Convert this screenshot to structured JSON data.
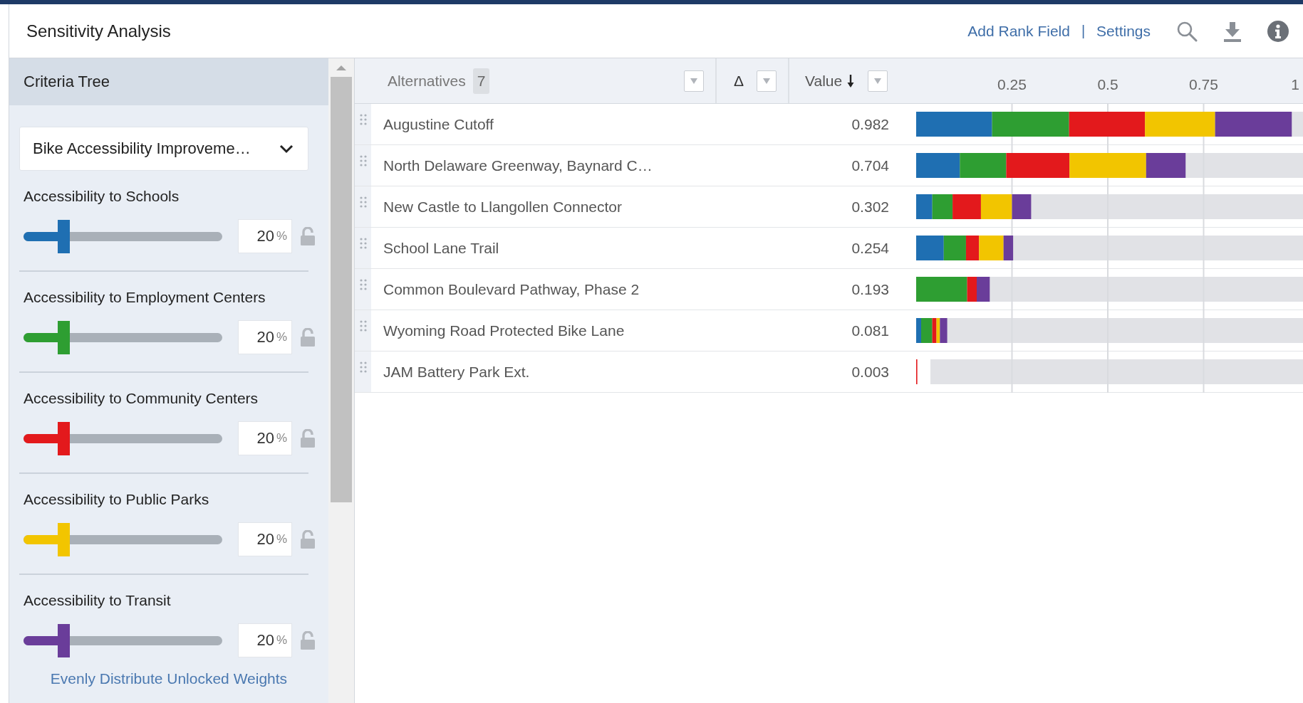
{
  "header": {
    "title": "Sensitivity Analysis",
    "links": [
      "Add Rank Field",
      "Settings"
    ],
    "separator": "|"
  },
  "criteria_tree": {
    "title": "Criteria Tree",
    "dropdown": {
      "value": "Bike Accessibility Improveme…"
    },
    "criteria": [
      {
        "name": "Accessibility to Schools",
        "color": "#1f6fb2",
        "level": 0.2,
        "weight": "20",
        "unit": "%",
        "locked": false
      },
      {
        "name": "Accessibility to Employment Centers",
        "color": "#2e9e32",
        "level": 0.2,
        "weight": "20",
        "unit": "%",
        "locked": false
      },
      {
        "name": "Accessibility to Community Centers",
        "color": "#e3191c",
        "level": 0.2,
        "weight": "20",
        "unit": "%",
        "locked": false
      },
      {
        "name": "Accessibility to Public Parks",
        "color": "#f2c500",
        "level": 0.2,
        "weight": "20",
        "unit": "%",
        "locked": false
      },
      {
        "name": "Accessibility to Transit",
        "color": "#6a3d9a",
        "level": 0.2,
        "weight": "20",
        "unit": "%",
        "locked": false
      }
    ],
    "action": "Evenly Distribute Unlocked Weights"
  },
  "table": {
    "columns": [
      {
        "label": "Alternatives",
        "count": "7"
      },
      {
        "label": "Δ"
      },
      {
        "label": "Value",
        "sort_descending": true
      }
    ],
    "rows": [
      {
        "name": "Augustine Cutoff",
        "value": "0.982"
      },
      {
        "name": "North Delaware Greenway, Baynard C…",
        "value": "0.704"
      },
      {
        "name": "New Castle to Llangollen Connector",
        "value": "0.302"
      },
      {
        "name": "School Lane Trail",
        "value": "0.254"
      },
      {
        "name": "Common Boulevard Pathway, Phase 2",
        "value": "0.193"
      },
      {
        "name": "Wyoming Road Protected Bike Lane",
        "value": "0.081"
      },
      {
        "name": "JAM Battery Park Ext.",
        "value": "0.003"
      }
    ],
    "chart_data": {
      "type": "bar",
      "orientation": "horizontal",
      "stacked": true,
      "grid": true,
      "xlim": [
        0,
        1
      ],
      "xticks": [
        {
          "value": 0.25,
          "label": "0.25"
        },
        {
          "value": 0.5,
          "label": "0.5"
        },
        {
          "value": 0.75,
          "label": "0.75"
        },
        {
          "value": 1,
          "label": "1"
        }
      ],
      "series": [
        {
          "color": "#1f6fb2",
          "values": [
            0.198,
            0.114,
            0.042,
            0.072,
            0,
            0.013,
            0
          ]
        },
        {
          "color": "#2e9e32",
          "values": [
            0.201,
            0.121,
            0.053,
            0.058,
            0.133,
            0.029,
            0
          ]
        },
        {
          "color": "#e3191c",
          "values": [
            0.198,
            0.165,
            0.074,
            0.034,
            0.025,
            0.011,
            0.003
          ]
        },
        {
          "color": "#f2c500",
          "values": [
            0.183,
            0.2,
            0.081,
            0.064,
            0,
            0.009,
            0
          ]
        },
        {
          "color": "#6a3d9a",
          "values": [
            0.2,
            0.103,
            0.05,
            0.025,
            0.034,
            0.019,
            0
          ]
        }
      ]
    }
  }
}
